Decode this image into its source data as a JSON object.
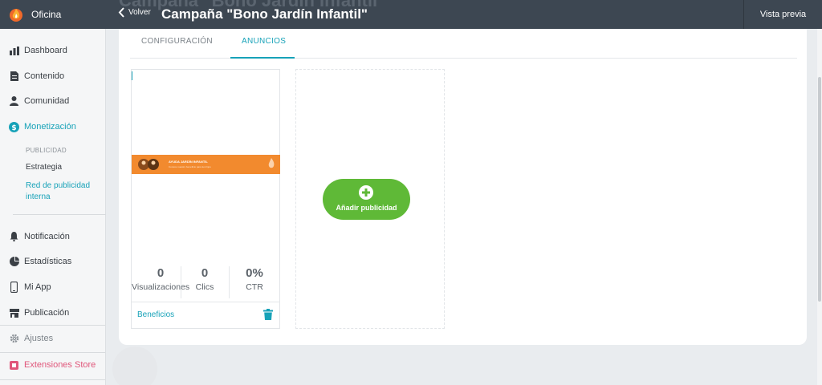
{
  "brand": {
    "name": "Oficina",
    "icon": "flame-icon"
  },
  "header": {
    "back_label": "Volver",
    "title": "Campaña \"Bono Jardín Infantil\"",
    "preview_label": "Vista previa"
  },
  "sidebar": {
    "items": [
      {
        "label": "Dashboard",
        "icon": "bar-chart-icon"
      },
      {
        "label": "Contenido",
        "icon": "document-icon"
      },
      {
        "label": "Comunidad",
        "icon": "user-icon"
      },
      {
        "label": "Monetización",
        "icon": "dollar-circle-icon"
      },
      {
        "label": "Notificación",
        "icon": "bell-icon"
      },
      {
        "label": "Estadísticas",
        "icon": "pie-chart-icon"
      },
      {
        "label": "Mi App",
        "icon": "phone-icon"
      },
      {
        "label": "Publicación",
        "icon": "store-icon"
      },
      {
        "label": "Ajustes",
        "icon": "gear-icon"
      },
      {
        "label": "Extensiones Store",
        "icon": "extension-icon"
      }
    ],
    "sub_heading": "PUBLICIDAD",
    "sub_items": [
      "Estrategia",
      "Red de publicidad interna"
    ]
  },
  "tabs": [
    "CONFIGURACIÓN",
    "ANUNCIOS"
  ],
  "ad": {
    "banner_title": "AYUDA JARDÍN INFANTIL",
    "banner_sub": "Conoce nuestro beneficio para tus hijos",
    "stats": [
      {
        "value": "0",
        "label": "Visualizaciones"
      },
      {
        "value": "0",
        "label": "Clics"
      },
      {
        "value": "0%",
        "label": "CTR"
      }
    ],
    "footer_link": "Beneficios"
  },
  "add_button": {
    "label": "Añadir publicidad"
  },
  "colors": {
    "accent": "#17a2b8",
    "topbar": "#3d4752",
    "add_green": "#5fb937",
    "banner_orange": "#f28a2e"
  }
}
